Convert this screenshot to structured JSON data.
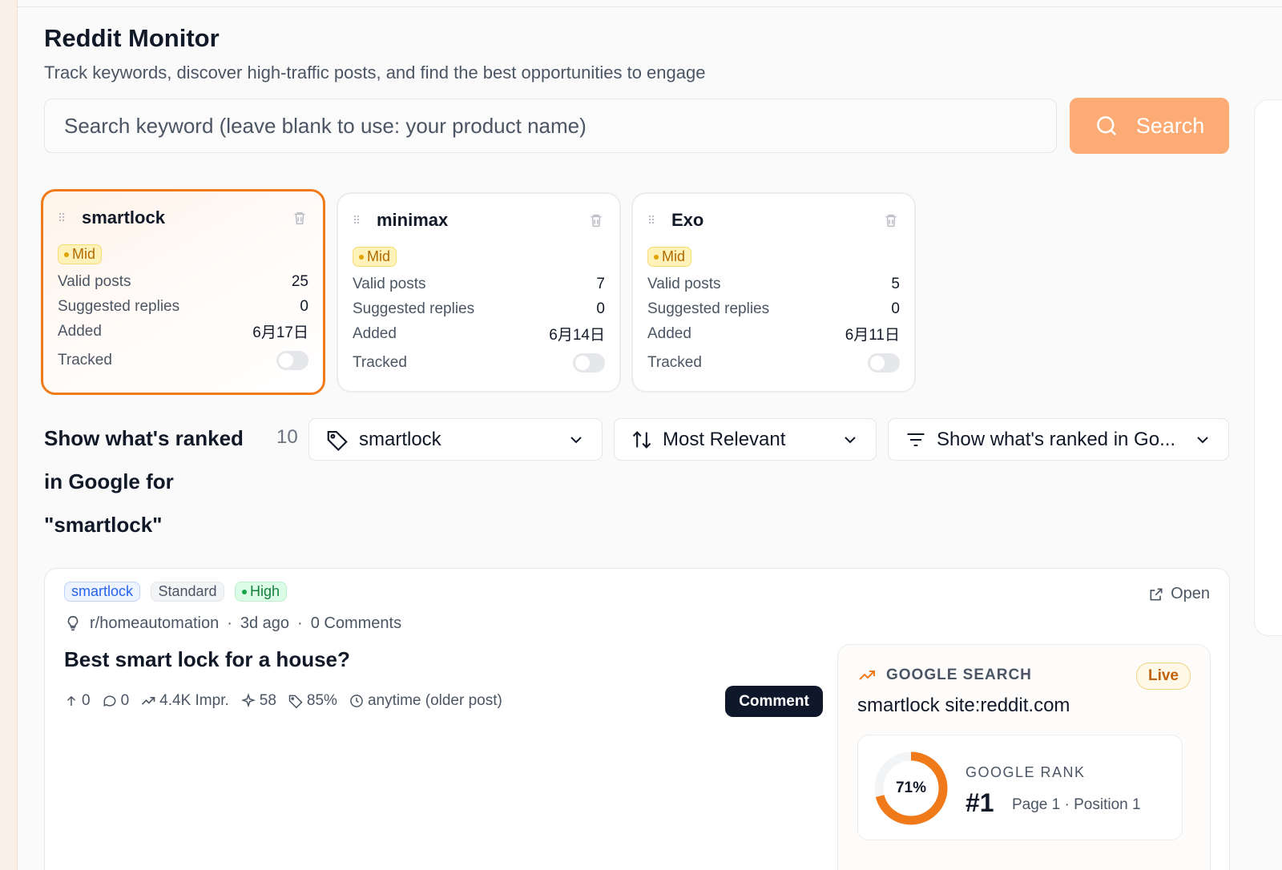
{
  "header": {
    "title": "Reddit Monitor",
    "subtitle": "Track keywords, discover high-traffic posts, and find the best opportunities to engage"
  },
  "search": {
    "placeholder": "Search keyword (leave blank to use: your product name)",
    "button_label": "Search"
  },
  "keywords": [
    {
      "name": "smartlock",
      "level": "Mid",
      "valid_posts_label": "Valid posts",
      "valid_posts": "25",
      "suggested_label": "Suggested replies",
      "suggested": "0",
      "added_label": "Added",
      "added": "6月17日",
      "tracked_label": "Tracked",
      "tracked": false,
      "selected": true
    },
    {
      "name": "minimax",
      "level": "Mid",
      "valid_posts_label": "Valid posts",
      "valid_posts": "7",
      "suggested_label": "Suggested replies",
      "suggested": "0",
      "added_label": "Added",
      "added": "6月14日",
      "tracked_label": "Tracked",
      "tracked": false,
      "selected": false
    },
    {
      "name": "Exo",
      "level": "Mid",
      "valid_posts_label": "Valid posts",
      "valid_posts": "5",
      "suggested_label": "Suggested replies",
      "suggested": "0",
      "added_label": "Added",
      "added": "6月11日",
      "tracked_label": "Tracked",
      "tracked": false,
      "selected": false
    }
  ],
  "results": {
    "title_line1": "Show what's ranked",
    "title_line2": "in Google for",
    "title_line3": "\"smartlock\"",
    "count": "10",
    "keyword_filter": "smartlock",
    "sort": "Most Relevant",
    "view_filter": "Show what's ranked in Go..."
  },
  "post": {
    "tags": {
      "keyword": "smartlock",
      "type": "Standard",
      "priority": "High"
    },
    "subreddit": "r/homeautomation",
    "age": "3d ago",
    "comments": "0 Comments",
    "title": "Best smart lock for a house?",
    "stats": {
      "upvotes": "0",
      "comment_count": "0",
      "impressions": "4.4K Impr.",
      "score": "58",
      "relevance": "85%",
      "time": "anytime (older post)"
    },
    "comment_button": "Comment",
    "open_label": "Open"
  },
  "google": {
    "section_label": "GOOGLE SEARCH",
    "status": "Live",
    "query": "smartlock site:reddit.com",
    "rank_label": "GOOGLE RANK",
    "percent_label": "71%",
    "percent_value": 0.71,
    "rank": "#1",
    "position": "Page 1 · Position 1"
  },
  "colors": {
    "accent": "#f07a1a",
    "search_button": "#fbab73",
    "mid_badge": "#fff2b8",
    "high_badge": "#dcfce7"
  }
}
